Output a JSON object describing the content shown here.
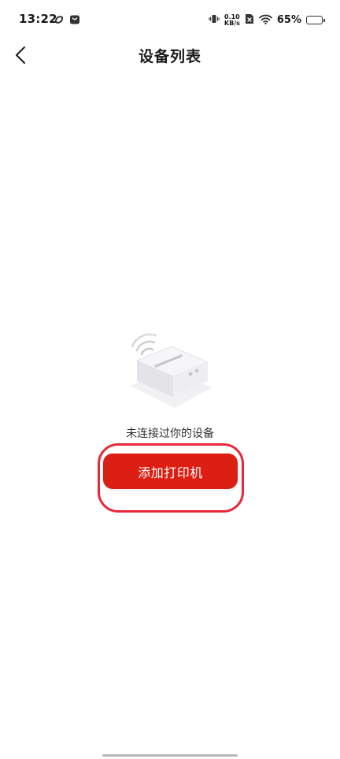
{
  "status_bar": {
    "time": "13:22",
    "net_speed_value": "0.10",
    "net_speed_unit": "KB/s",
    "battery_percent": "65%",
    "battery_level": 0.65
  },
  "header": {
    "title": "设备列表"
  },
  "empty_state": {
    "message": "未连接过你的设备",
    "button_label": "添加打印机"
  },
  "colors": {
    "accent": "#dc1f12",
    "highlight": "#e8283a"
  },
  "icons": {
    "back": "chevron-left-icon",
    "illustration": "printer-icon"
  }
}
